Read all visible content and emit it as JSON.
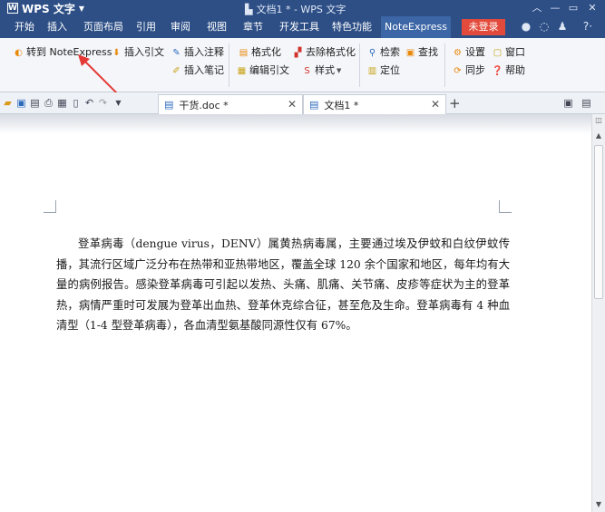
{
  "title_bar": {
    "app_name": "WPS 文字",
    "doc_title": "文档1 * - WPS 文字"
  },
  "menu": {
    "tabs": [
      "开始",
      "插入",
      "页面布局",
      "引用",
      "审阅",
      "视图",
      "章节",
      "开发工具",
      "特色功能",
      "NoteExpress"
    ],
    "active_tab": "NoteExpress",
    "login_label": "未登录"
  },
  "ribbon": {
    "goto_ne": "转到 NoteExpress",
    "insert_citation": "插入引文",
    "insert_annotation": "插入注释",
    "insert_note": "插入笔记",
    "format": "格式化",
    "remove_format": "去除格式化",
    "edit_citation": "编辑引文",
    "style": "样式",
    "search": "检索",
    "find": "查找",
    "locate": "定位",
    "settings": "设置",
    "window": "窗口",
    "sync": "同步",
    "help": "帮助"
  },
  "tabs": {
    "doc1": "干货.doc *",
    "doc2": "文档1 *"
  },
  "document": {
    "text": "登革病毒（dengue virus，DENV）属黄热病毒属，主要通过埃及伊蚊和白纹伊蚊传播，其流行区域广泛分布在热带和亚热带地区，覆盖全球 120 余个国家和地区，每年均有大量的病例报告。感染登革病毒可引起以发热、头痛、肌痛、关节痛、皮疹等症状为主的登革热，病情严重时可发展为登革出血热、登革休克综合征，甚至危及生命。登革病毒有 4 种血清型（1-4 型登革病毒），各血清型氨基酸同源性仅有 67%。"
  },
  "colors": {
    "title_bar": "#2d4f86",
    "active_tab": "#3c66a6",
    "login_button": "#e24b3b",
    "annotation_arrow": "#e53935"
  }
}
